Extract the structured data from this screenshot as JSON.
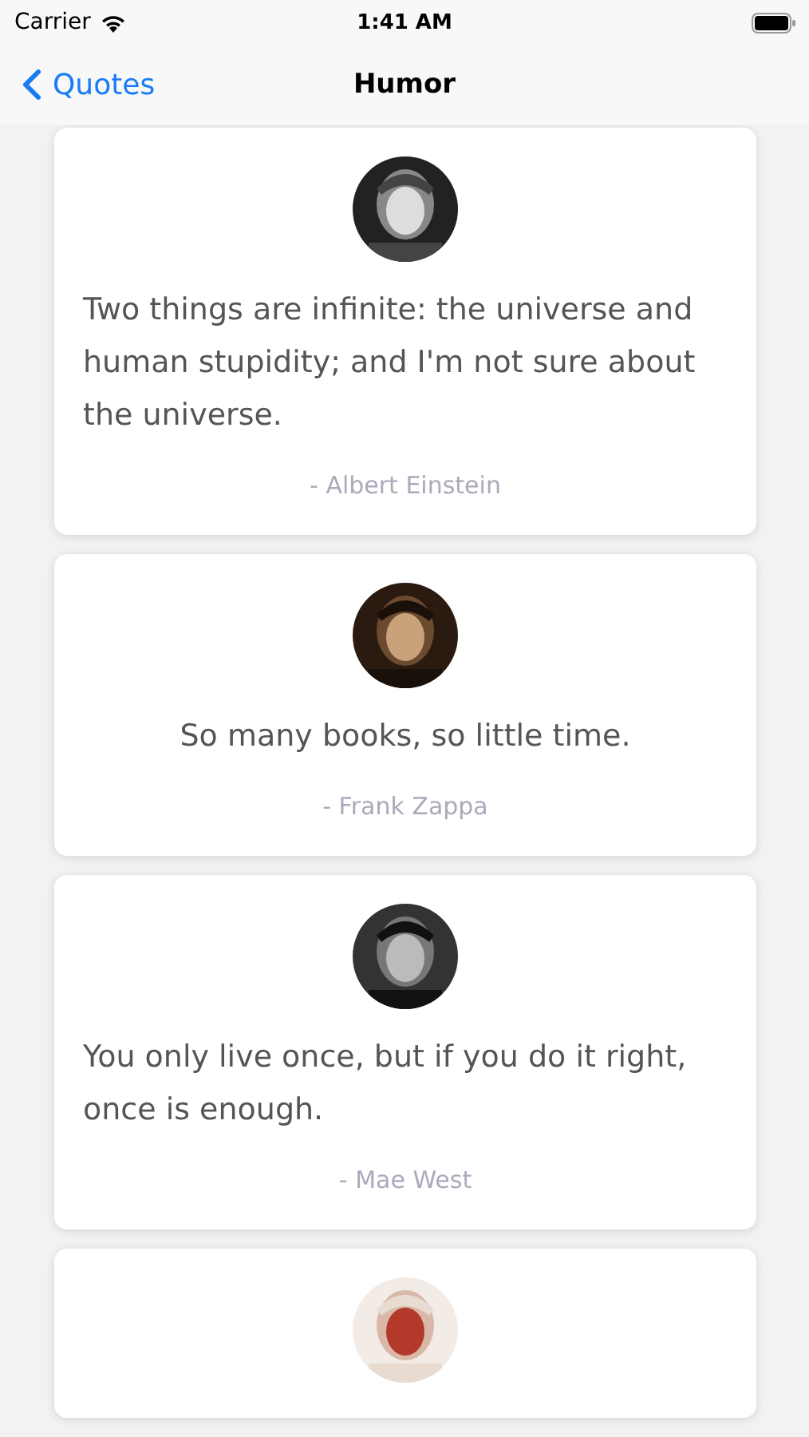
{
  "status_bar": {
    "carrier": "Carrier",
    "time": "1:41 AM"
  },
  "nav": {
    "back": "Quotes",
    "title": "Humor"
  },
  "quotes": [
    {
      "text": "Two things are infinite: the universe and human stupidity; and I'm not sure about the universe.",
      "author": "- Albert Einstein",
      "avatar": {
        "kind": "picture"
      }
    },
    {
      "text": "So many books, so little time.",
      "author": "- Frank Zappa",
      "avatar": {
        "kind": "picture"
      }
    },
    {
      "text": "You only live once, but if you do it right, once is enough.",
      "author": "- Mae West",
      "avatar": {
        "kind": "picture"
      }
    },
    {
      "avatar": {
        "kind": "picture"
      }
    }
  ]
}
